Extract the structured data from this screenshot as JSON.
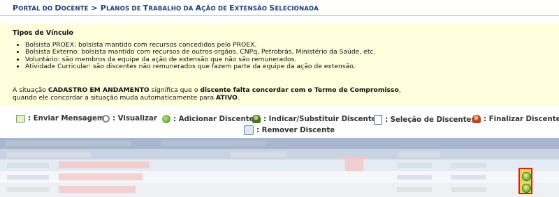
{
  "breadcrumb": {
    "part1_big": "P",
    "part1_small": "ORTAL DO ",
    "part2_big": "D",
    "part2_small": "OCENTE",
    "separator": " > ",
    "part3_big": "P",
    "part3_small": "LANOS DE ",
    "part4_big": "T",
    "part4_small": "RABALHO DA ",
    "part5_big": "A",
    "part5_small": "ÇÃO DE ",
    "part6_big": "E",
    "part6_small": "XTENSÃO ",
    "part7_big": "S",
    "part7_small": "ELECIONADA"
  },
  "info": {
    "title": "Tipos de Vínculo",
    "items": [
      "Bolsista PROEX: bolsista mantido com recursos concedidos pelo PROEX.",
      "Bolsista Externo: bolsista mantido com recursos de outros orgãos. CNPq, Petrobrás, Ministério da Saúde, etc.",
      "Voluntário: são membros da equipe da ação de extensão que não são remunerados.",
      "Atividade Curricular: são discentes não remunerados que fazem parte da equipe da ação de extensão."
    ],
    "note_prefix": "A situação ",
    "note_bold1": "CADASTRO EM ANDAMENTO",
    "note_mid": " significa que o ",
    "note_bold2": "discente falta concordar com o Termo de Compromisso",
    "note_comma": ",",
    "note_line2": "quando ele concordar a situação muda automaticamente para ",
    "note_bold3": "ATIVO",
    "note_end": "."
  },
  "toolbar": {
    "enviar": ": Enviar Mensagem",
    "visualizar": ": Visualizar",
    "adicionar": ": Adicionar Discente",
    "indicar": ": Indicar/Substituir Discente",
    "selecao": ": Seleção de Discentes",
    "finalizar": ": Finalizar Discente",
    "remover": ": Remover Discente"
  },
  "icons": {
    "enviar": "envelope-icon",
    "visualizar": "magnifier-icon",
    "adicionar": "plus-circle-icon",
    "indicar": "user-swap-icon",
    "selecao": "list-icon",
    "finalizar": "user-finish-icon",
    "remover": "remove-icon",
    "row_action": "green-arrow-icon"
  },
  "colors": {
    "breadcrumb": "#1c3f7a",
    "info_background": "#ffffdd",
    "table_header": "#a8b6cf",
    "highlight_border": "#e21b1b"
  }
}
